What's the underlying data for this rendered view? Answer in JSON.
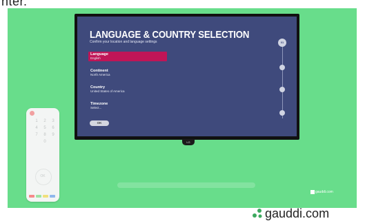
{
  "top_text": "nter.",
  "tv": {
    "title": "LANGUAGE & COUNTRY SELECTION",
    "subtitle": "Confirm your location and language settings",
    "menu": [
      {
        "label": "Language",
        "value": "English",
        "selected": true
      },
      {
        "label": "Continent",
        "value": "North America",
        "selected": false
      },
      {
        "label": "Country",
        "value": "United States of America",
        "selected": false
      },
      {
        "label": "Timezone",
        "value": "Select...",
        "selected": false
      }
    ],
    "ok_label": "OK",
    "step_label": "01",
    "brand": "LG"
  },
  "remote": {
    "keys": [
      "1",
      "2",
      "3",
      "4",
      "5",
      "6",
      "7",
      "8",
      "9",
      "",
      "0",
      ""
    ],
    "ok_label": "OK",
    "color_buttons": [
      "#f58a8a",
      "#9fe3a4",
      "#f0e07c",
      "#8fb7ec"
    ]
  },
  "watermark": "gauddi.com",
  "footer_brand": "gauddi.com",
  "colors": {
    "background": "#68dd8b",
    "screen": "#3f4a7c",
    "accent": "#c01557"
  }
}
